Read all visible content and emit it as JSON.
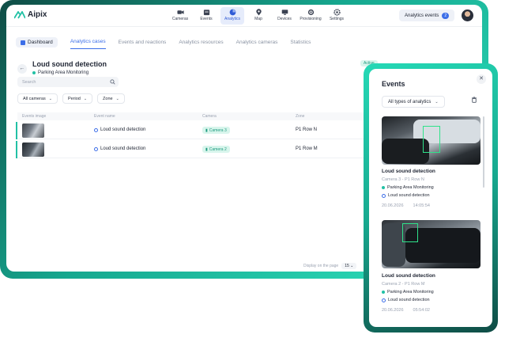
{
  "app": {
    "name": "Aipix"
  },
  "nav": [
    {
      "label": "Cameras",
      "icon": "camera-icon"
    },
    {
      "label": "Events",
      "icon": "events-icon"
    },
    {
      "label": "Analytics",
      "icon": "analytics-icon",
      "active": true
    },
    {
      "label": "Map",
      "icon": "map-pin-icon"
    },
    {
      "label": "Devices",
      "icon": "devices-icon"
    },
    {
      "label": "Provisioning",
      "icon": "provisioning-icon"
    },
    {
      "label": "Settings",
      "icon": "gear-icon"
    }
  ],
  "header": {
    "analytics_events_label": "Analytics events",
    "analytics_events_count": "2"
  },
  "tabs": {
    "dashboard": "Dashboard",
    "items": [
      "Analytics cases",
      "Events and reactions",
      "Analytics resources",
      "Analytics cameras",
      "Statistics"
    ]
  },
  "page": {
    "title": "Loud sound detection",
    "subtitle": "Parking Area Monitoring",
    "status": "Active"
  },
  "search": {
    "placeholder": "Search"
  },
  "filters": [
    "All cameras",
    "Period",
    "Zone"
  ],
  "table": {
    "headers": [
      "Events image",
      "Event name",
      "Camera",
      "Zone"
    ],
    "rows": [
      {
        "name": "Loud sound detection",
        "camera": "Camera 3",
        "zone": "P1 Row N"
      },
      {
        "name": "Loud sound detection",
        "camera": "Camera 2",
        "zone": "P1 Row M"
      }
    ]
  },
  "pagination": {
    "label": "Display on the page",
    "value": "15"
  },
  "events_panel": {
    "title": "Events",
    "filter": "All types of analytics",
    "cards": [
      {
        "title": "Loud sound detection",
        "camera": "Camera 3 - P1 Row N",
        "case": "Parking Area Monitoring",
        "event": "Loud sound detection",
        "date": "20.06.2026",
        "time": "14:05:54"
      },
      {
        "title": "Loud sound detection",
        "camera": "Camera 2 - P1 Row M",
        "case": "Parking Area Monitoring",
        "event": "Loud sound detection",
        "date": "20.06.2026",
        "time": "05:54:02"
      }
    ]
  },
  "colors": {
    "accent": "#3c6ee8",
    "teal": "#22c1a5",
    "frame": "#16a88f"
  }
}
